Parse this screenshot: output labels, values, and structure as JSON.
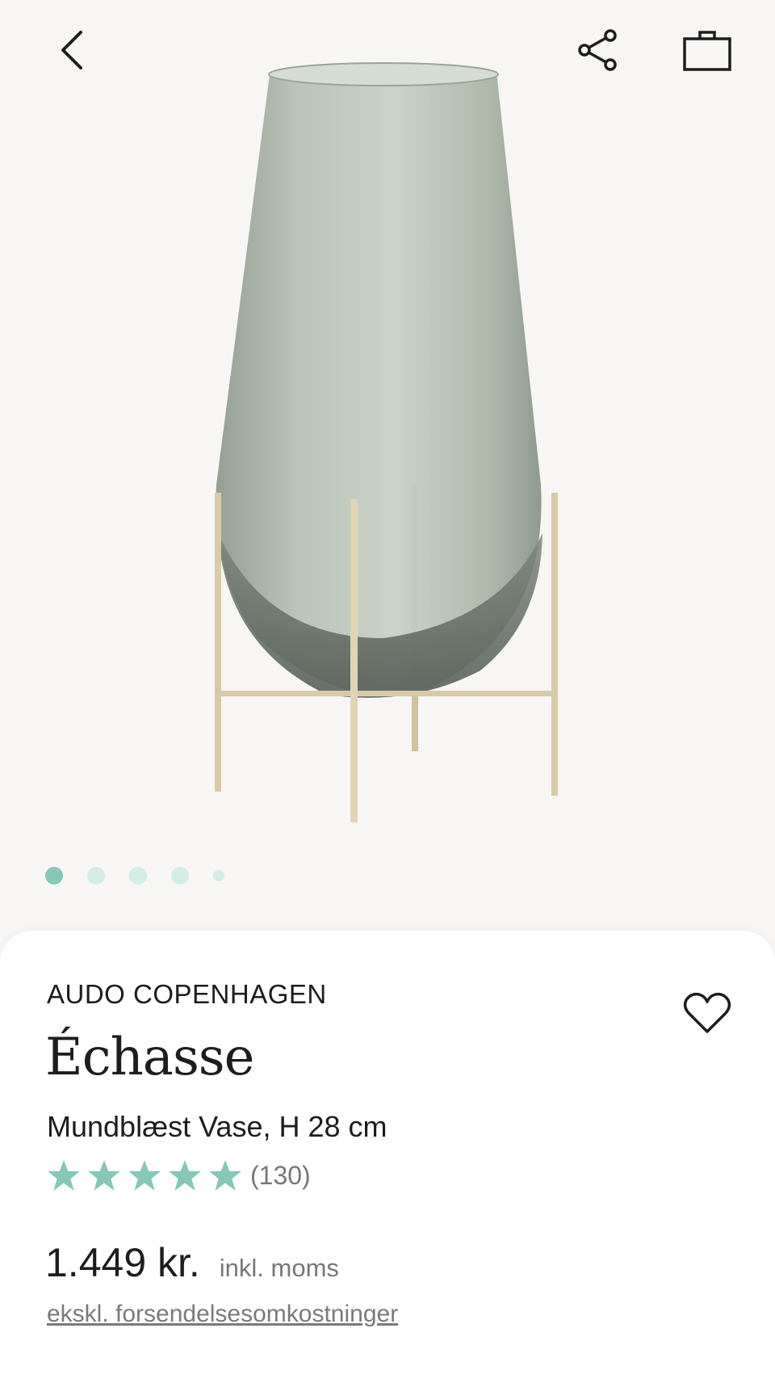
{
  "header": {
    "back_icon": "chevron-left-icon",
    "share_icon": "share-icon",
    "bag_icon": "shopping-bag-icon"
  },
  "gallery": {
    "image_subject": "smoke glass vase on brass stand",
    "dot_count": 5,
    "active_index": 0
  },
  "product": {
    "brand": "AUDO COPENHAGEN",
    "title": "Échasse",
    "subtitle": "Mundblæst Vase, H 28 cm",
    "rating_value": 5,
    "rating_count": "(130)",
    "price": "1.449 kr.",
    "vat_note": "inkl. moms",
    "shipping_link": "ekskl. forsendelsesomkostninger",
    "wishlist_icon": "heart-icon"
  },
  "colors": {
    "accent": "#86c7b5",
    "accent_light": "#d3ede6",
    "background": "#f8f6f4",
    "text": "#1d1d1d",
    "muted": "#777777"
  }
}
